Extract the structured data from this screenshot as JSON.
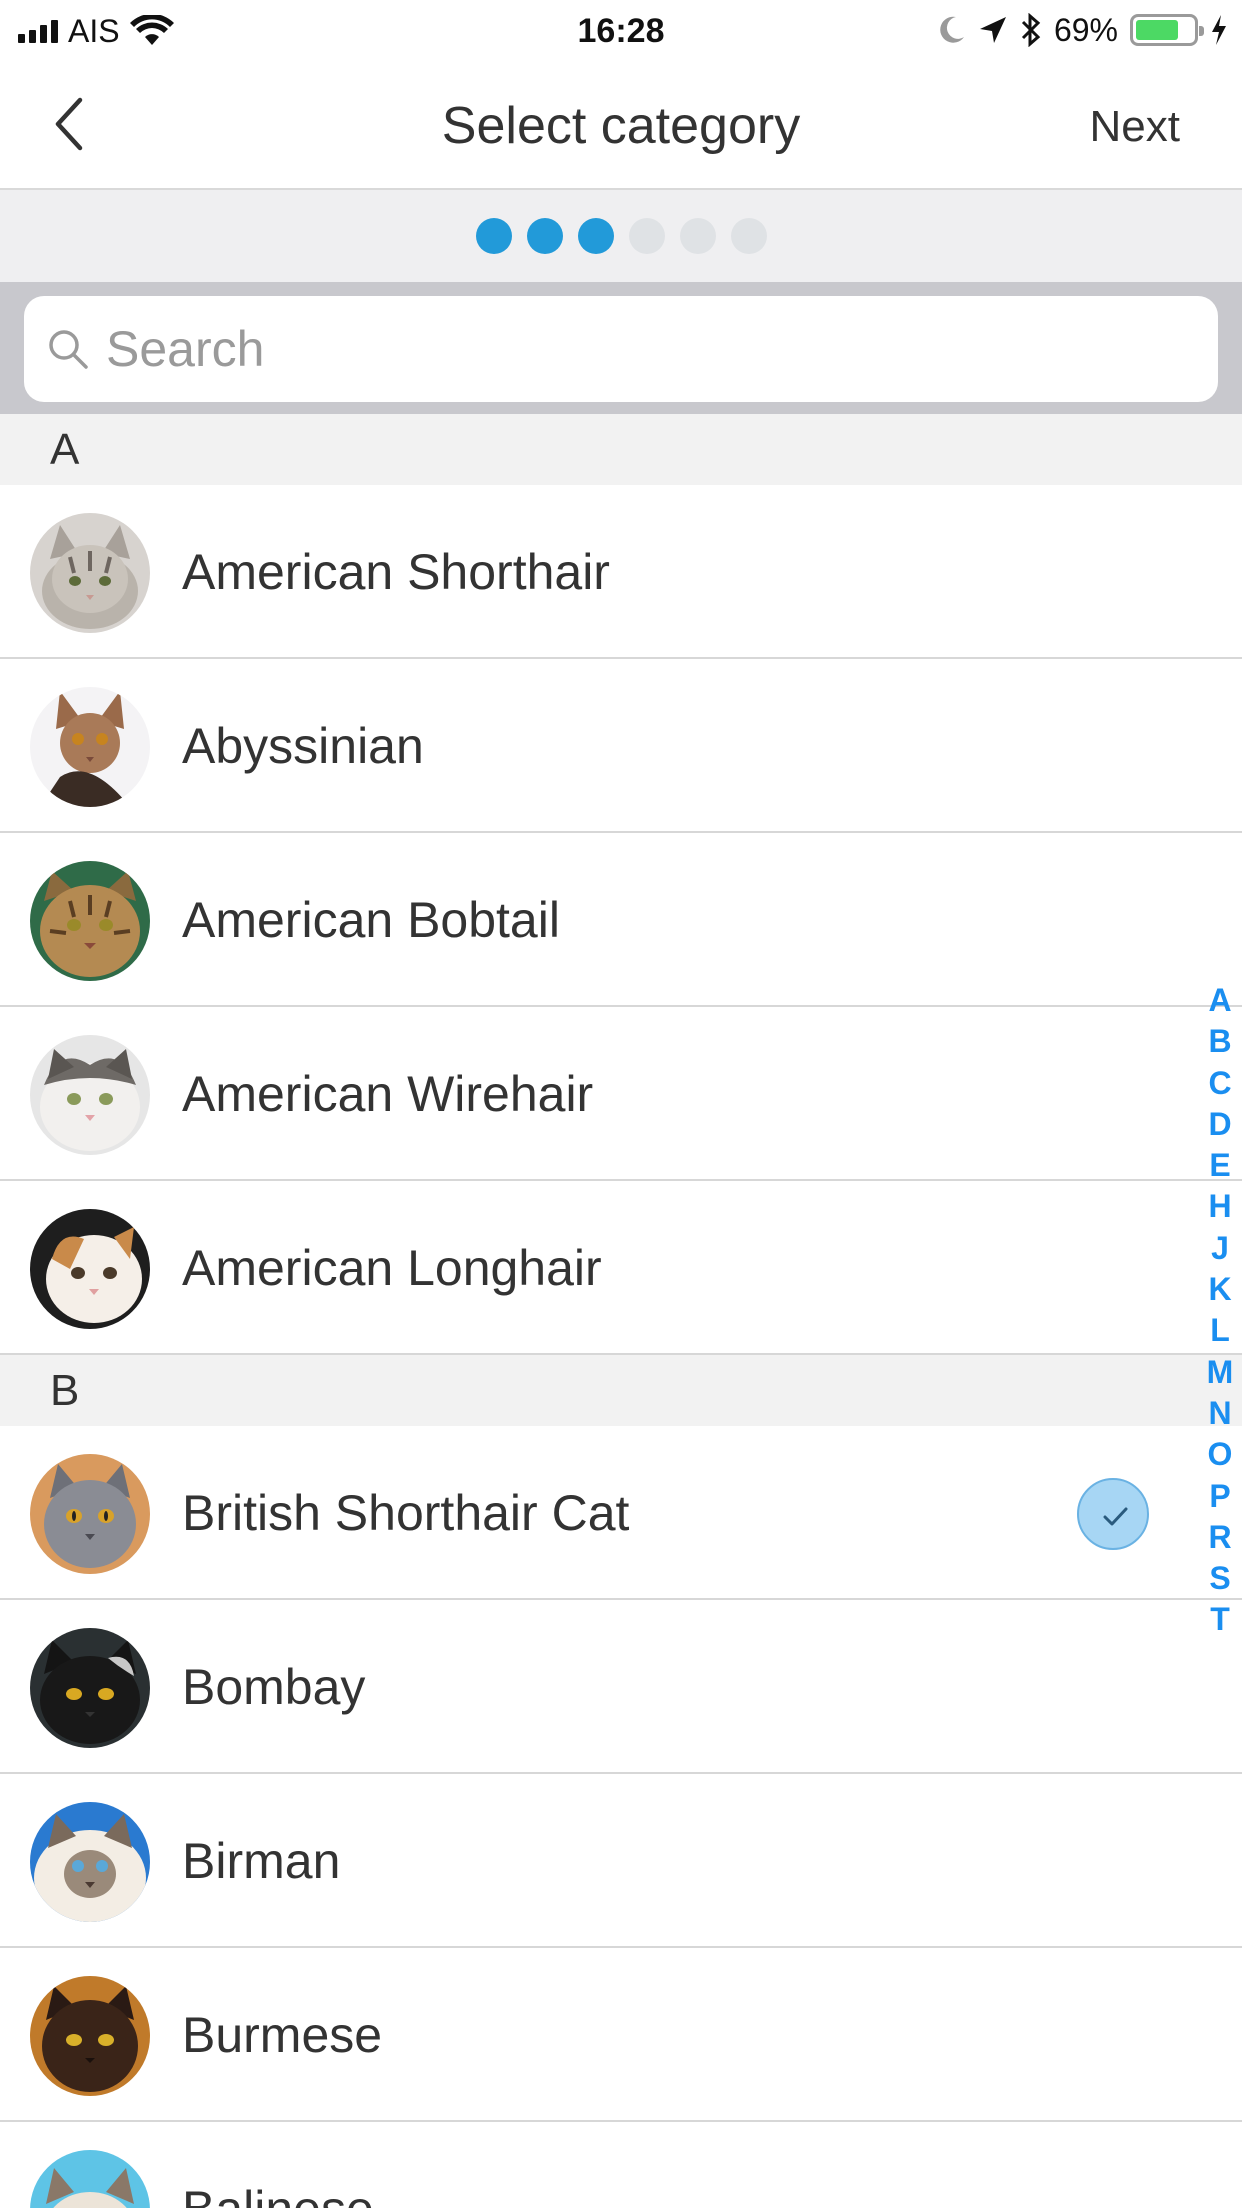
{
  "status_bar": {
    "carrier": "AIS",
    "time": "16:28",
    "battery_percent": "69%",
    "battery_level": 0.69,
    "icons": [
      "signal-icon",
      "wifi-icon",
      "moon-icon",
      "location-arrow-icon",
      "bluetooth-icon",
      "battery-icon",
      "charging-bolt-icon"
    ]
  },
  "nav": {
    "title": "Select category",
    "next_label": "Next",
    "back_icon": "chevron-left-icon"
  },
  "progress": {
    "total_steps": 6,
    "current_step": 3,
    "active_color": "#229ad9",
    "inactive_color": "#dfe2e5"
  },
  "search": {
    "placeholder": "Search",
    "value": "",
    "icon": "search-icon"
  },
  "sections": [
    {
      "letter": "A",
      "items": [
        {
          "name": "American Shorthair",
          "selected": false
        },
        {
          "name": "Abyssinian",
          "selected": false
        },
        {
          "name": "American Bobtail",
          "selected": false
        },
        {
          "name": "American Wirehair",
          "selected": false
        },
        {
          "name": "American Longhair",
          "selected": false
        }
      ]
    },
    {
      "letter": "B",
      "items": [
        {
          "name": "British Shorthair Cat",
          "selected": true
        },
        {
          "name": "Bombay",
          "selected": false
        },
        {
          "name": "Birman",
          "selected": false
        },
        {
          "name": "Burmese",
          "selected": false
        },
        {
          "name": "Balinese",
          "selected": false
        }
      ]
    }
  ],
  "index_letters": [
    "A",
    "B",
    "C",
    "D",
    "E",
    "H",
    "J",
    "K",
    "L",
    "M",
    "N",
    "O",
    "P",
    "R",
    "S",
    "T"
  ],
  "colors": {
    "accent": "#229ad9",
    "index": "#1a8ef0",
    "check_fill": "#a7d6f4"
  }
}
